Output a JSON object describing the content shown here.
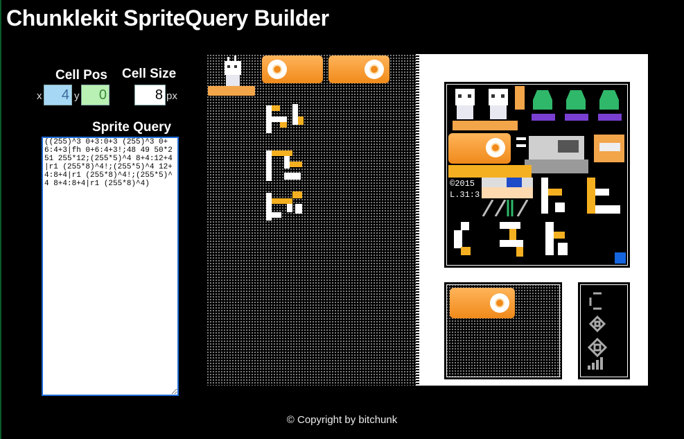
{
  "app": {
    "title": "Chunklekit SpriteQuery Builder"
  },
  "cell_pos": {
    "heading": "Cell Pos",
    "x_label": "x",
    "y_label": "y",
    "x_value": "4",
    "y_value": "0"
  },
  "cell_size": {
    "heading": "Cell Size",
    "value": "8",
    "unit": "px"
  },
  "sprite_query": {
    "heading": "Sprite Query",
    "text": "((255)^3 0+3:0+3 (255)^3 0+6:4+3|fh 0+6:4+3!;48 49 50*2 51 255*12;(255*5)^4 8+4:12+4|r1 (255*8)^4!;(255*5)^4 12+4:8+4|r1 (255*8)^4!;(255*5)^4 8+4:8+4|r1 (255*8)^4)"
  },
  "preview": {
    "copyright_text": "©2015",
    "level_text": "L.31:3"
  },
  "footer": {
    "text": "© Copyright by bitchunk"
  },
  "colors": {
    "background": "#000000",
    "x_field": "#a6d8f5",
    "y_field": "#b9f0b3",
    "query_border": "#1e6bd6",
    "orange": "#f08a1a",
    "green": "#2fb86a",
    "blue_marker": "#1565e0"
  },
  "icons": [
    "sprite-sheet-image",
    "roll-sprite",
    "alien-sprite",
    "character-sprite",
    "blue-marker-icon"
  ]
}
